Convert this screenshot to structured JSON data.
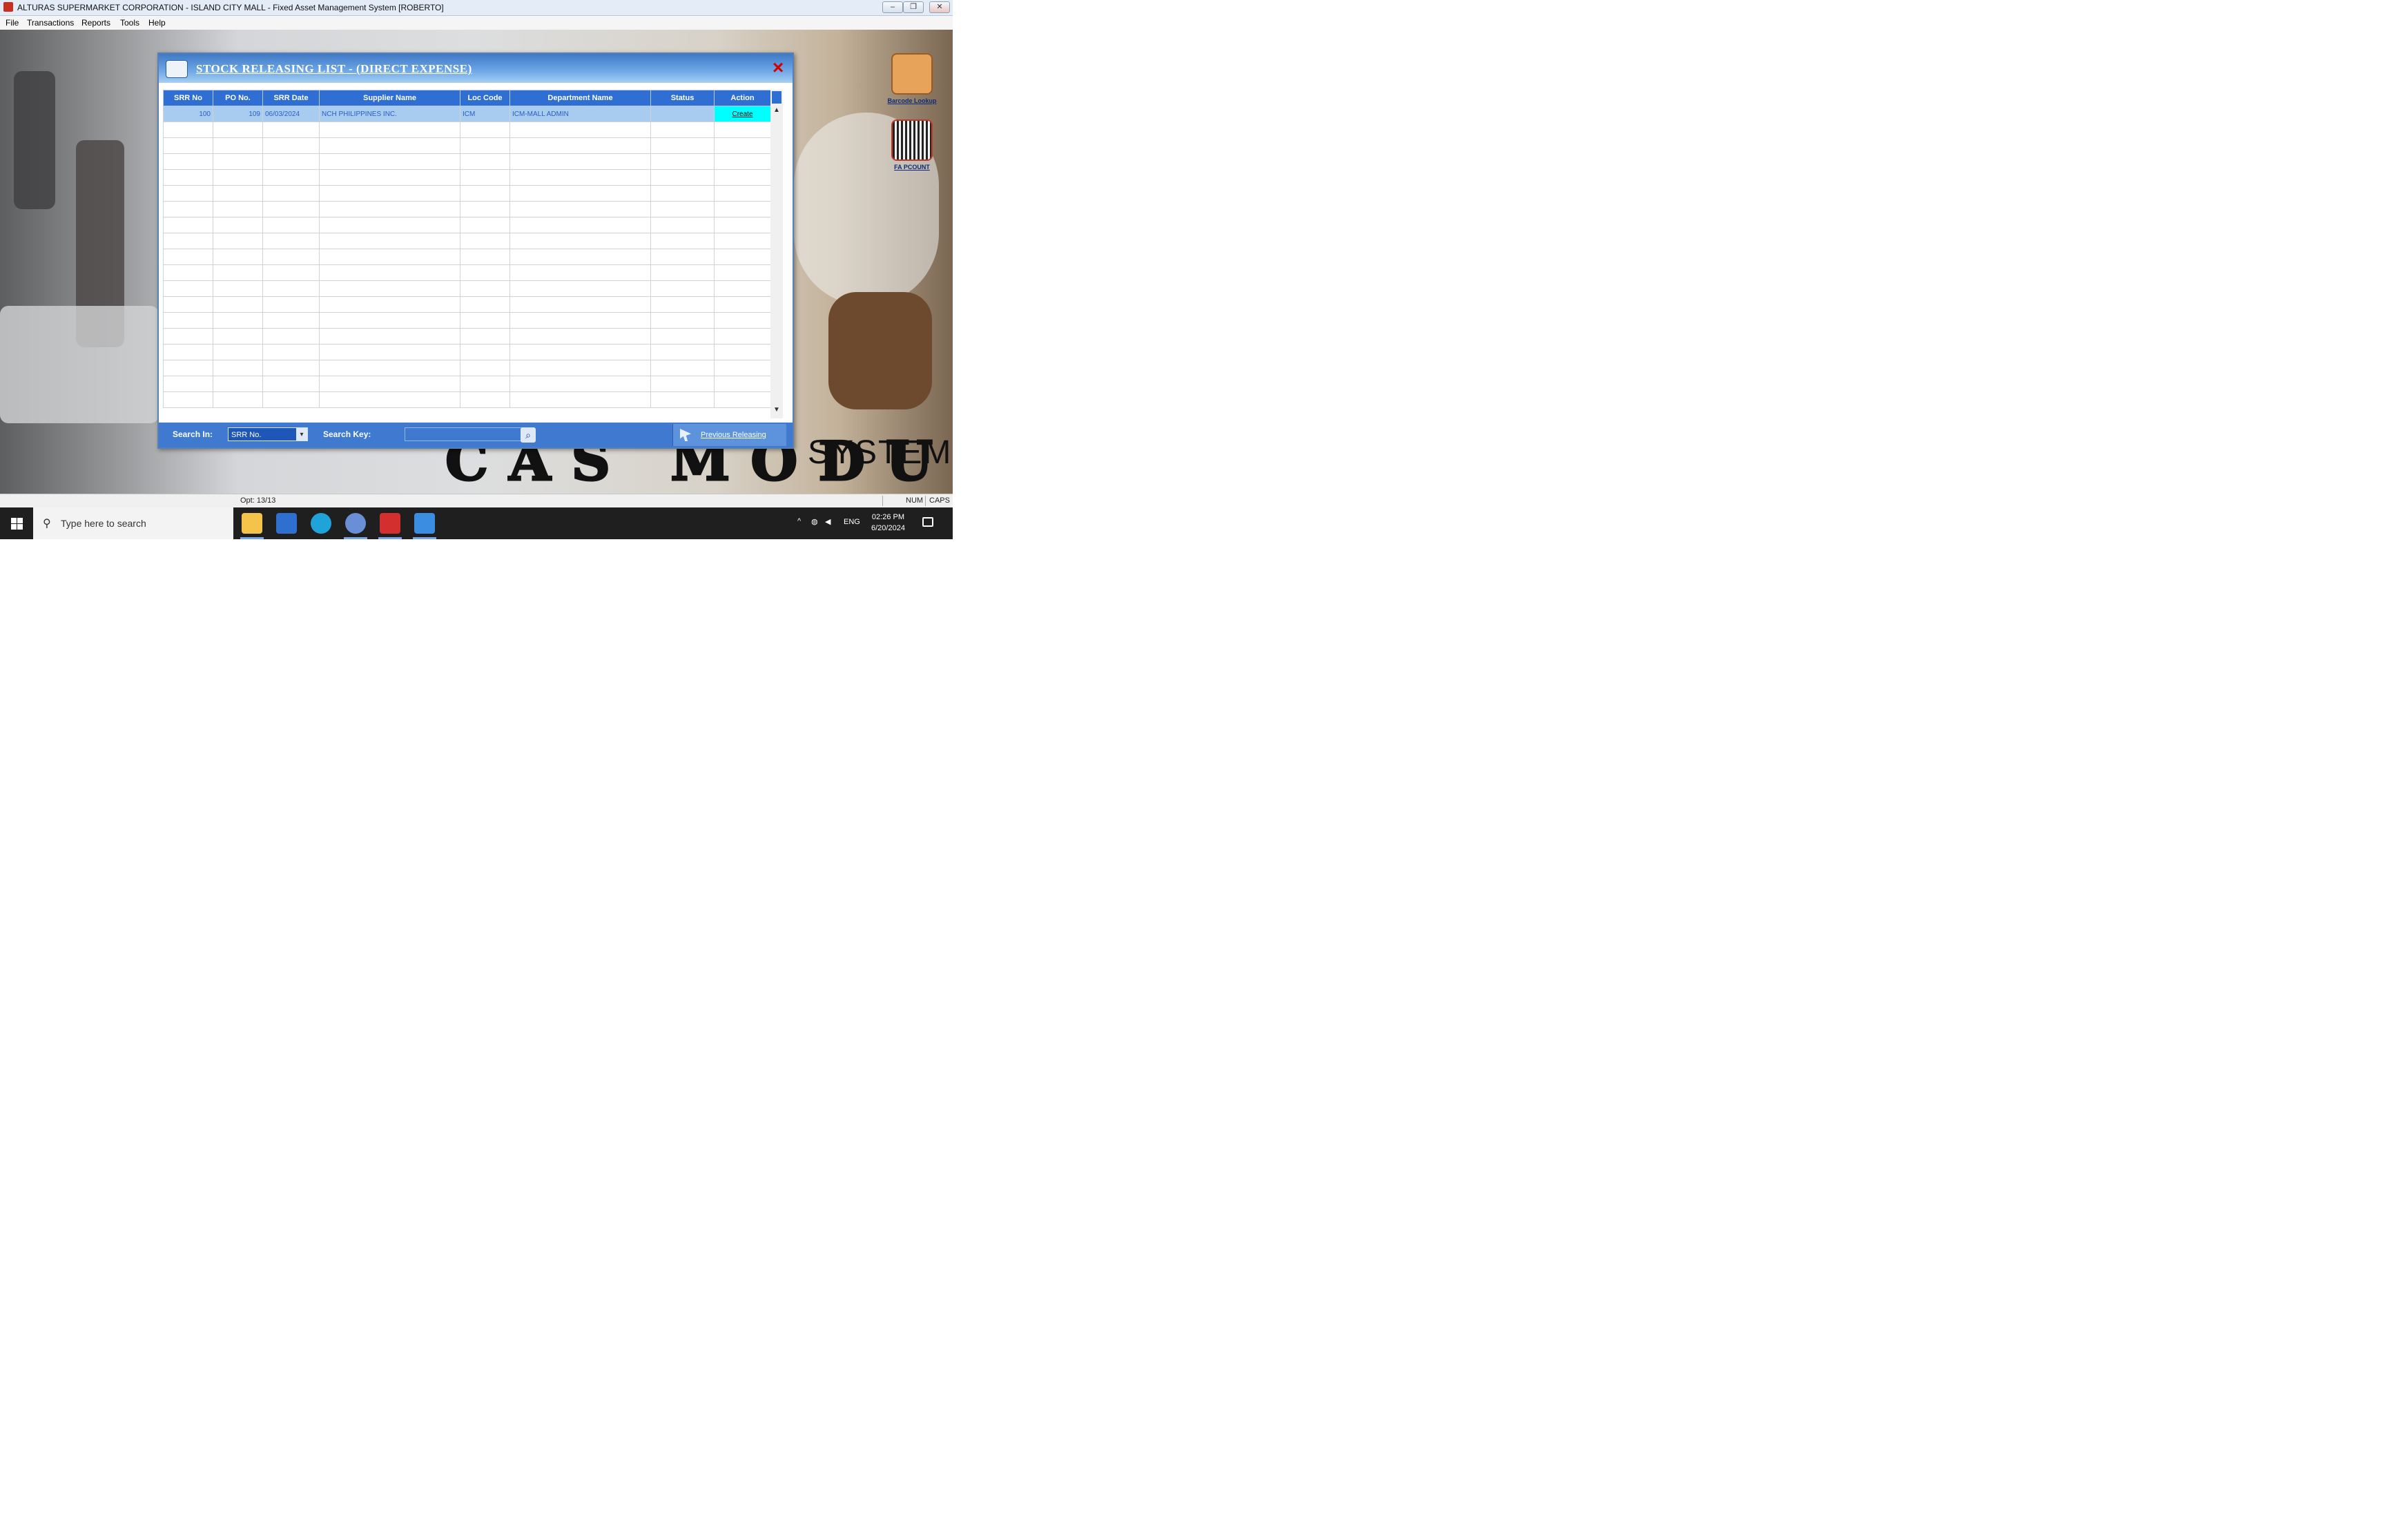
{
  "window": {
    "title": "ALTURAS SUPERMARKET CORPORATION - ISLAND CITY MALL - Fixed Asset Management System [ROBERTO]",
    "controls": {
      "minimize": "–",
      "restore": "❐",
      "close": "✕"
    }
  },
  "menu": [
    "File",
    "Transactions",
    "Reports",
    "Tools",
    "Help"
  ],
  "desktop": {
    "shortcuts": [
      {
        "label": "Barcode Lookup",
        "icon": "barcode-scanner-icon"
      },
      {
        "label": "FA PCOUNT",
        "icon": "barcode-count-icon"
      }
    ],
    "banner_system": "SYSTEM",
    "banner_module": "CAS MODULE"
  },
  "dialog": {
    "title": "STOCK RELEASING LIST - (DIRECT EXPENSE)",
    "close_icon": "×",
    "columns": [
      "SRR No",
      "PO No.",
      "SRR Date",
      "Supplier Name",
      "Loc Code",
      "Department Name",
      "Status",
      "Action"
    ],
    "rows": [
      {
        "srr_no": "100",
        "po_no": "109",
        "srr_date": "06/03/2024",
        "supplier": "NCH PHILIPPINES INC.",
        "loc_code": "ICM",
        "department": "ICM-MALL ADMIN",
        "status": "",
        "action": "Create"
      }
    ],
    "empty_rows": 18,
    "search_in_label": "Search In:",
    "search_in_value": "SRR No.",
    "search_key_label": "Search Key:",
    "search_key_value": "",
    "previous_releasing": "Previous Releasing"
  },
  "statusbar": {
    "left": "Opt: 13/13",
    "num": "NUM",
    "caps": "CAPS"
  },
  "taskbar": {
    "search_placeholder": "Type here to search",
    "lang": "ENG",
    "time": "02:26 PM",
    "date": "6/20/2024"
  },
  "colors": {
    "dialog_header": "#2f6fd3",
    "selected_row": "#a8cbf0",
    "action_cell": "#00ffff",
    "bottom_bar": "#3f7ad0"
  }
}
